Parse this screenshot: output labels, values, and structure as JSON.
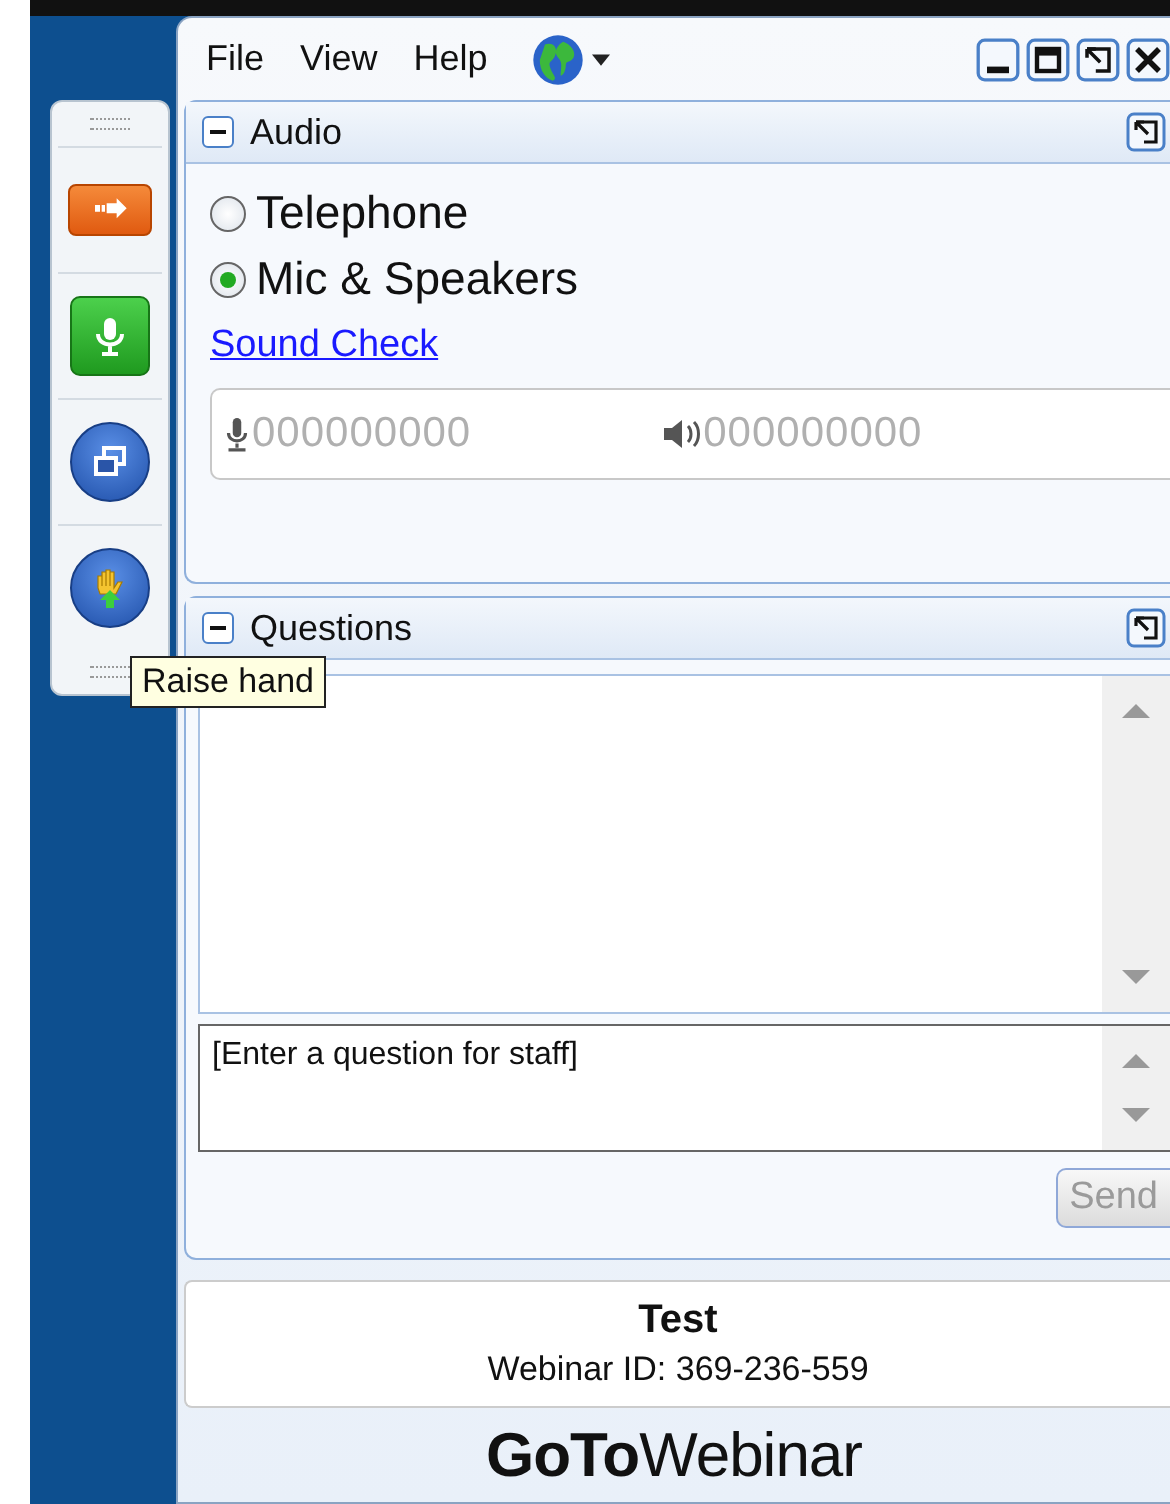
{
  "toolbar": {
    "buttons": [
      {
        "kind": "arrow"
      },
      {
        "kind": "mic"
      },
      {
        "kind": "window"
      },
      {
        "kind": "hand"
      }
    ]
  },
  "tooltip": "Raise hand",
  "menu": [
    "File",
    "View",
    "Help"
  ],
  "audio": {
    "title": "Audio",
    "options": [
      {
        "label": "Telephone",
        "selected": false
      },
      {
        "label": "Mic & Speakers",
        "selected": true
      }
    ],
    "link": "Sound Check",
    "mic_reading": "000000000",
    "speaker_reading": "000000000"
  },
  "questions": {
    "title": "Questions",
    "placeholder": "[Enter a question for staff]",
    "send": {
      "label": "Send",
      "disabled": true
    }
  },
  "footer": {
    "title": "Test",
    "webinar_id": "Webinar ID: 369-236-559",
    "logo": "**GoTo**Webinar"
  }
}
